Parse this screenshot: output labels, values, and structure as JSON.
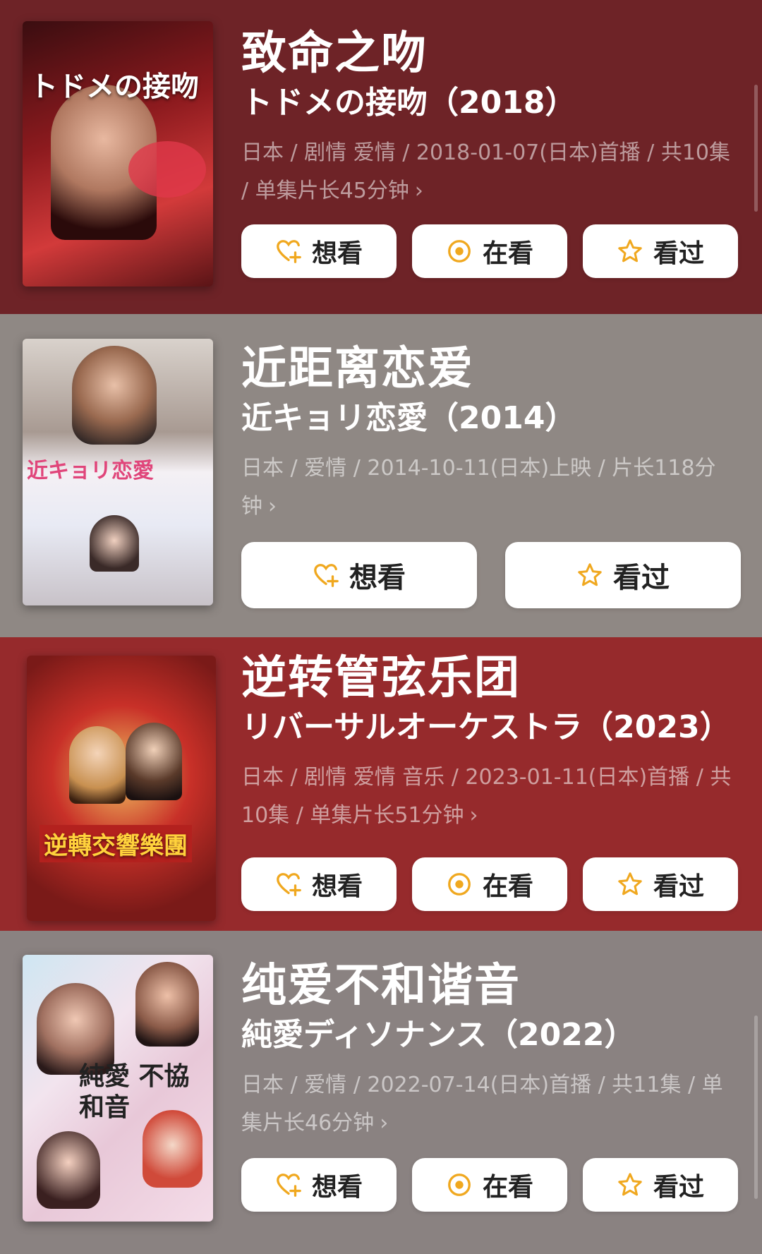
{
  "colors": {
    "card1_bg": "#6e2327",
    "card2_bg": "#8f8884",
    "card3_bg": "#962a2c",
    "card4_bg": "#8a8281",
    "accent_icon": "#f0a81f"
  },
  "items": [
    {
      "title_cn": "致命之吻",
      "title_orig": "トドメの接吻（2018）",
      "meta": "日本 / 剧情 爱情 / 2018-01-07(日本)首播 / 共10集 / 单集片长45分钟",
      "poster_text": "トドメの接吻",
      "buttons": {
        "want": "想看",
        "watching": "在看",
        "watched": "看过"
      }
    },
    {
      "title_cn": "近距离恋爱",
      "title_orig": "近キョリ恋愛（2014）",
      "meta": "日本 / 爱情 / 2014-10-11(日本)上映 / 片长118分钟",
      "poster_text": "近キョリ恋愛",
      "buttons": {
        "want": "想看",
        "watched": "看过"
      }
    },
    {
      "title_cn": "逆转管弦乐团",
      "title_orig": "リバーサルオーケストラ（2023）",
      "meta": "日本 / 剧情 爱情 音乐 / 2023-01-11(日本)首播 / 共10集 / 单集片长51分钟",
      "poster_text": "逆轉交響樂團",
      "buttons": {
        "want": "想看",
        "watching": "在看",
        "watched": "看过"
      }
    },
    {
      "title_cn": "纯爱不和谐音",
      "title_orig": "純愛ディソナンス（2022）",
      "meta": "日本 / 爱情 / 2022-07-14(日本)首播 / 共11集 / 单集片长46分钟",
      "poster_text": "純愛 不協和音",
      "buttons": {
        "want": "想看",
        "watching": "在看",
        "watched": "看过"
      }
    }
  ],
  "chevron": "›"
}
